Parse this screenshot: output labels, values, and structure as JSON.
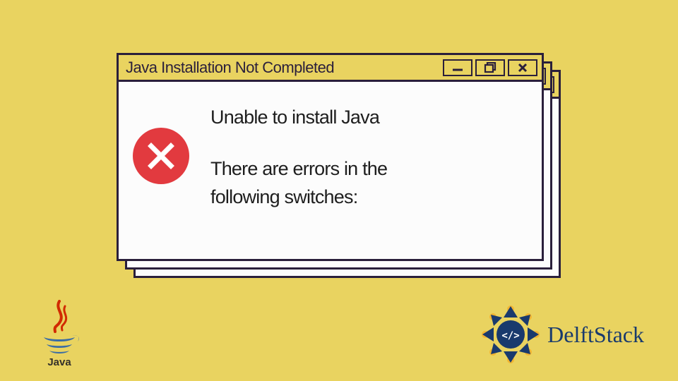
{
  "window": {
    "title": "Java Installation Not Completed",
    "message1": "Unable to install Java",
    "message2a": "There are errors in the",
    "message2b": "following switches:"
  },
  "colors": {
    "background": "#e9d360",
    "border": "#2a1f3b",
    "errorRed": "#e23a3f",
    "javaRed": "#d12a00",
    "javaBlue": "#3a6ca4",
    "delftBlue": "#193a6d"
  },
  "logos": {
    "java": "Java",
    "delft": "DelftStack"
  }
}
